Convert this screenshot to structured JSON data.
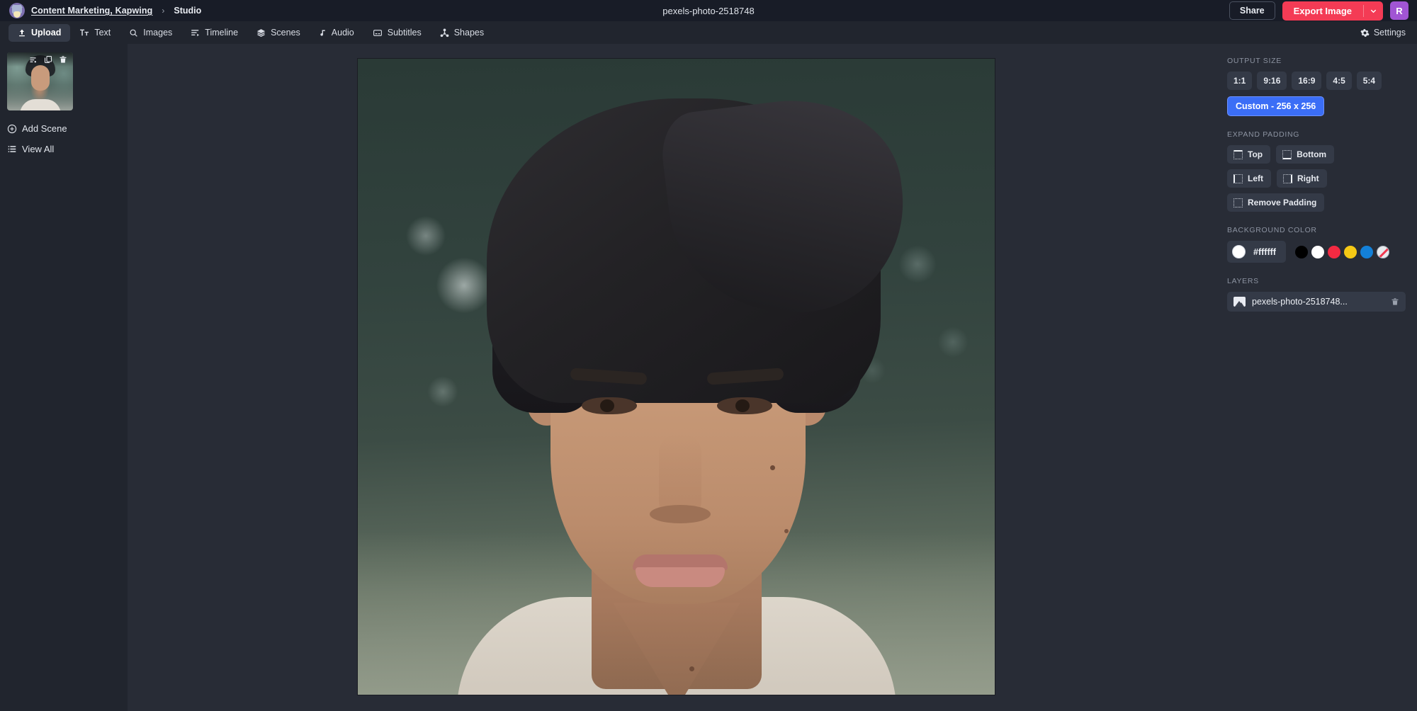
{
  "header": {
    "logo_icon": "kapwing-cat-avatar-icon",
    "breadcrumb_project": "Content Marketing, Kapwing",
    "breadcrumb_separator": "›",
    "breadcrumb_current": "Studio",
    "document_title": "pexels-photo-2518748",
    "share_label": "Share",
    "export_label": "Export Image",
    "export_caret_icon": "chevron-down-icon",
    "user_initial": "R",
    "accent_export": "#f43b55",
    "accent_avatar": "#a155d4"
  },
  "nav": {
    "items": [
      {
        "label": "Upload",
        "icon": "upload-icon",
        "active": true
      },
      {
        "label": "Text",
        "icon": "text-icon",
        "active": false
      },
      {
        "label": "Images",
        "icon": "search-icon",
        "active": false
      },
      {
        "label": "Timeline",
        "icon": "timeline-icon",
        "active": false
      },
      {
        "label": "Scenes",
        "icon": "layers-icon",
        "active": false
      },
      {
        "label": "Audio",
        "icon": "music-note-icon",
        "active": false
      },
      {
        "label": "Subtitles",
        "icon": "subtitles-icon",
        "active": false
      },
      {
        "label": "Shapes",
        "icon": "shapes-icon",
        "active": false
      }
    ],
    "settings_label": "Settings",
    "settings_icon": "gear-icon"
  },
  "scenes": {
    "thumb_tools": [
      {
        "icon": "reorder-icon"
      },
      {
        "icon": "duplicate-icon"
      },
      {
        "icon": "trash-icon"
      }
    ],
    "add_scene_label": "Add Scene",
    "add_scene_icon": "plus-circle-icon",
    "view_all_label": "View All",
    "view_all_icon": "list-icon"
  },
  "right_panel": {
    "output_size": {
      "label": "Output Size",
      "ratios": [
        "1:1",
        "9:16",
        "16:9",
        "4:5",
        "5:4"
      ],
      "custom_label": "Custom - 256 x 256",
      "custom_selected": true,
      "selected_color": "#3b6ef6"
    },
    "expand_padding": {
      "label": "Expand Padding",
      "buttons": [
        {
          "label": "Top",
          "edge": "top",
          "icon": "pad-top-icon"
        },
        {
          "label": "Bottom",
          "edge": "bottom",
          "icon": "pad-bottom-icon"
        },
        {
          "label": "Left",
          "edge": "left",
          "icon": "pad-left-icon"
        },
        {
          "label": "Right",
          "edge": "right",
          "icon": "pad-right-icon"
        }
      ],
      "remove_label": "Remove Padding",
      "remove_icon": "pad-remove-icon"
    },
    "background_color": {
      "label": "Background Color",
      "current_hex": "#ffffff",
      "swatches": [
        "#000000",
        "#ffffff",
        "#f42a42",
        "#f6c915",
        "#1380d8",
        "transparent"
      ]
    },
    "layers": {
      "label": "Layers",
      "items": [
        {
          "name": "pexels-photo-2518748...",
          "icon": "image-layer-icon",
          "delete_icon": "trash-icon"
        }
      ]
    }
  }
}
